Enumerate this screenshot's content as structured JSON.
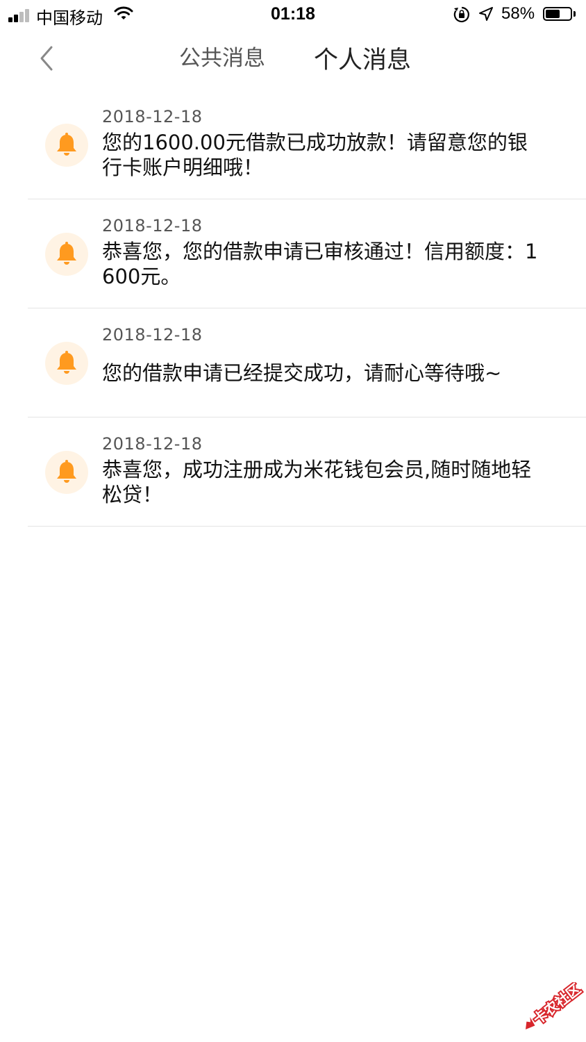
{
  "status_bar": {
    "carrier": "中国移动",
    "time": "01:18",
    "battery_percent": "58%",
    "battery_level": 0.58,
    "icons": [
      "signal-icon",
      "wifi-icon",
      "orientation-lock-icon",
      "location-arrow-icon",
      "battery-icon"
    ]
  },
  "header": {
    "back_icon": "chevron-left-icon",
    "tabs": [
      {
        "label": "公共消息",
        "active": false
      },
      {
        "label": "个人消息",
        "active": true
      }
    ]
  },
  "messages": [
    {
      "date": "2018-12-18",
      "text": "您的1600.00元借款已成功放款！请留意您的银行卡账户明细哦！",
      "icon": "bell-icon"
    },
    {
      "date": "2018-12-18",
      "text": "恭喜您，您的借款申请已审核通过！信用额度：1600元。",
      "icon": "bell-icon"
    },
    {
      "date": "2018-12-18",
      "text": "您的借款申请已经提交成功，请耐心等待哦~",
      "icon": "bell-icon"
    },
    {
      "date": "2018-12-18",
      "text": "恭喜您，成功注册成为米花钱包会员,随时随地轻松贷！",
      "icon": "bell-icon"
    }
  ],
  "watermark": {
    "text": "卡农社区"
  },
  "colors": {
    "accent": "#ff9a1f",
    "bell_bg": "#fff3e4",
    "divider": "#e4e4e4",
    "watermark": "#d8262c"
  }
}
